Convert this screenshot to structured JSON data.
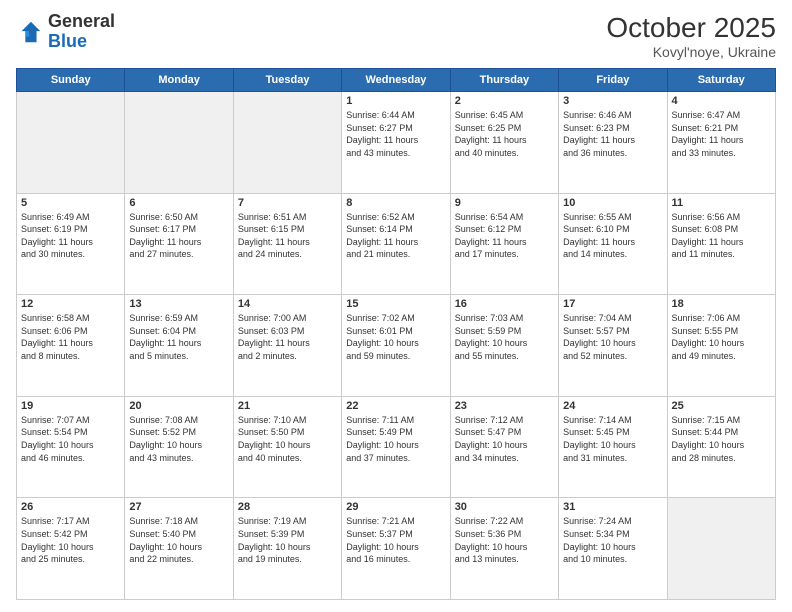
{
  "header": {
    "logo_general": "General",
    "logo_blue": "Blue",
    "month_title": "October 2025",
    "location": "Kovyl'noye, Ukraine"
  },
  "days_of_week": [
    "Sunday",
    "Monday",
    "Tuesday",
    "Wednesday",
    "Thursday",
    "Friday",
    "Saturday"
  ],
  "weeks": [
    [
      {
        "day": null,
        "info": null
      },
      {
        "day": null,
        "info": null
      },
      {
        "day": null,
        "info": null
      },
      {
        "day": "1",
        "info": "Sunrise: 6:44 AM\nSunset: 6:27 PM\nDaylight: 11 hours\nand 43 minutes."
      },
      {
        "day": "2",
        "info": "Sunrise: 6:45 AM\nSunset: 6:25 PM\nDaylight: 11 hours\nand 40 minutes."
      },
      {
        "day": "3",
        "info": "Sunrise: 6:46 AM\nSunset: 6:23 PM\nDaylight: 11 hours\nand 36 minutes."
      },
      {
        "day": "4",
        "info": "Sunrise: 6:47 AM\nSunset: 6:21 PM\nDaylight: 11 hours\nand 33 minutes."
      }
    ],
    [
      {
        "day": "5",
        "info": "Sunrise: 6:49 AM\nSunset: 6:19 PM\nDaylight: 11 hours\nand 30 minutes."
      },
      {
        "day": "6",
        "info": "Sunrise: 6:50 AM\nSunset: 6:17 PM\nDaylight: 11 hours\nand 27 minutes."
      },
      {
        "day": "7",
        "info": "Sunrise: 6:51 AM\nSunset: 6:15 PM\nDaylight: 11 hours\nand 24 minutes."
      },
      {
        "day": "8",
        "info": "Sunrise: 6:52 AM\nSunset: 6:14 PM\nDaylight: 11 hours\nand 21 minutes."
      },
      {
        "day": "9",
        "info": "Sunrise: 6:54 AM\nSunset: 6:12 PM\nDaylight: 11 hours\nand 17 minutes."
      },
      {
        "day": "10",
        "info": "Sunrise: 6:55 AM\nSunset: 6:10 PM\nDaylight: 11 hours\nand 14 minutes."
      },
      {
        "day": "11",
        "info": "Sunrise: 6:56 AM\nSunset: 6:08 PM\nDaylight: 11 hours\nand 11 minutes."
      }
    ],
    [
      {
        "day": "12",
        "info": "Sunrise: 6:58 AM\nSunset: 6:06 PM\nDaylight: 11 hours\nand 8 minutes."
      },
      {
        "day": "13",
        "info": "Sunrise: 6:59 AM\nSunset: 6:04 PM\nDaylight: 11 hours\nand 5 minutes."
      },
      {
        "day": "14",
        "info": "Sunrise: 7:00 AM\nSunset: 6:03 PM\nDaylight: 11 hours\nand 2 minutes."
      },
      {
        "day": "15",
        "info": "Sunrise: 7:02 AM\nSunset: 6:01 PM\nDaylight: 10 hours\nand 59 minutes."
      },
      {
        "day": "16",
        "info": "Sunrise: 7:03 AM\nSunset: 5:59 PM\nDaylight: 10 hours\nand 55 minutes."
      },
      {
        "day": "17",
        "info": "Sunrise: 7:04 AM\nSunset: 5:57 PM\nDaylight: 10 hours\nand 52 minutes."
      },
      {
        "day": "18",
        "info": "Sunrise: 7:06 AM\nSunset: 5:55 PM\nDaylight: 10 hours\nand 49 minutes."
      }
    ],
    [
      {
        "day": "19",
        "info": "Sunrise: 7:07 AM\nSunset: 5:54 PM\nDaylight: 10 hours\nand 46 minutes."
      },
      {
        "day": "20",
        "info": "Sunrise: 7:08 AM\nSunset: 5:52 PM\nDaylight: 10 hours\nand 43 minutes."
      },
      {
        "day": "21",
        "info": "Sunrise: 7:10 AM\nSunset: 5:50 PM\nDaylight: 10 hours\nand 40 minutes."
      },
      {
        "day": "22",
        "info": "Sunrise: 7:11 AM\nSunset: 5:49 PM\nDaylight: 10 hours\nand 37 minutes."
      },
      {
        "day": "23",
        "info": "Sunrise: 7:12 AM\nSunset: 5:47 PM\nDaylight: 10 hours\nand 34 minutes."
      },
      {
        "day": "24",
        "info": "Sunrise: 7:14 AM\nSunset: 5:45 PM\nDaylight: 10 hours\nand 31 minutes."
      },
      {
        "day": "25",
        "info": "Sunrise: 7:15 AM\nSunset: 5:44 PM\nDaylight: 10 hours\nand 28 minutes."
      }
    ],
    [
      {
        "day": "26",
        "info": "Sunrise: 7:17 AM\nSunset: 5:42 PM\nDaylight: 10 hours\nand 25 minutes."
      },
      {
        "day": "27",
        "info": "Sunrise: 7:18 AM\nSunset: 5:40 PM\nDaylight: 10 hours\nand 22 minutes."
      },
      {
        "day": "28",
        "info": "Sunrise: 7:19 AM\nSunset: 5:39 PM\nDaylight: 10 hours\nand 19 minutes."
      },
      {
        "day": "29",
        "info": "Sunrise: 7:21 AM\nSunset: 5:37 PM\nDaylight: 10 hours\nand 16 minutes."
      },
      {
        "day": "30",
        "info": "Sunrise: 7:22 AM\nSunset: 5:36 PM\nDaylight: 10 hours\nand 13 minutes."
      },
      {
        "day": "31",
        "info": "Sunrise: 7:24 AM\nSunset: 5:34 PM\nDaylight: 10 hours\nand 10 minutes."
      },
      {
        "day": null,
        "info": null
      }
    ]
  ]
}
